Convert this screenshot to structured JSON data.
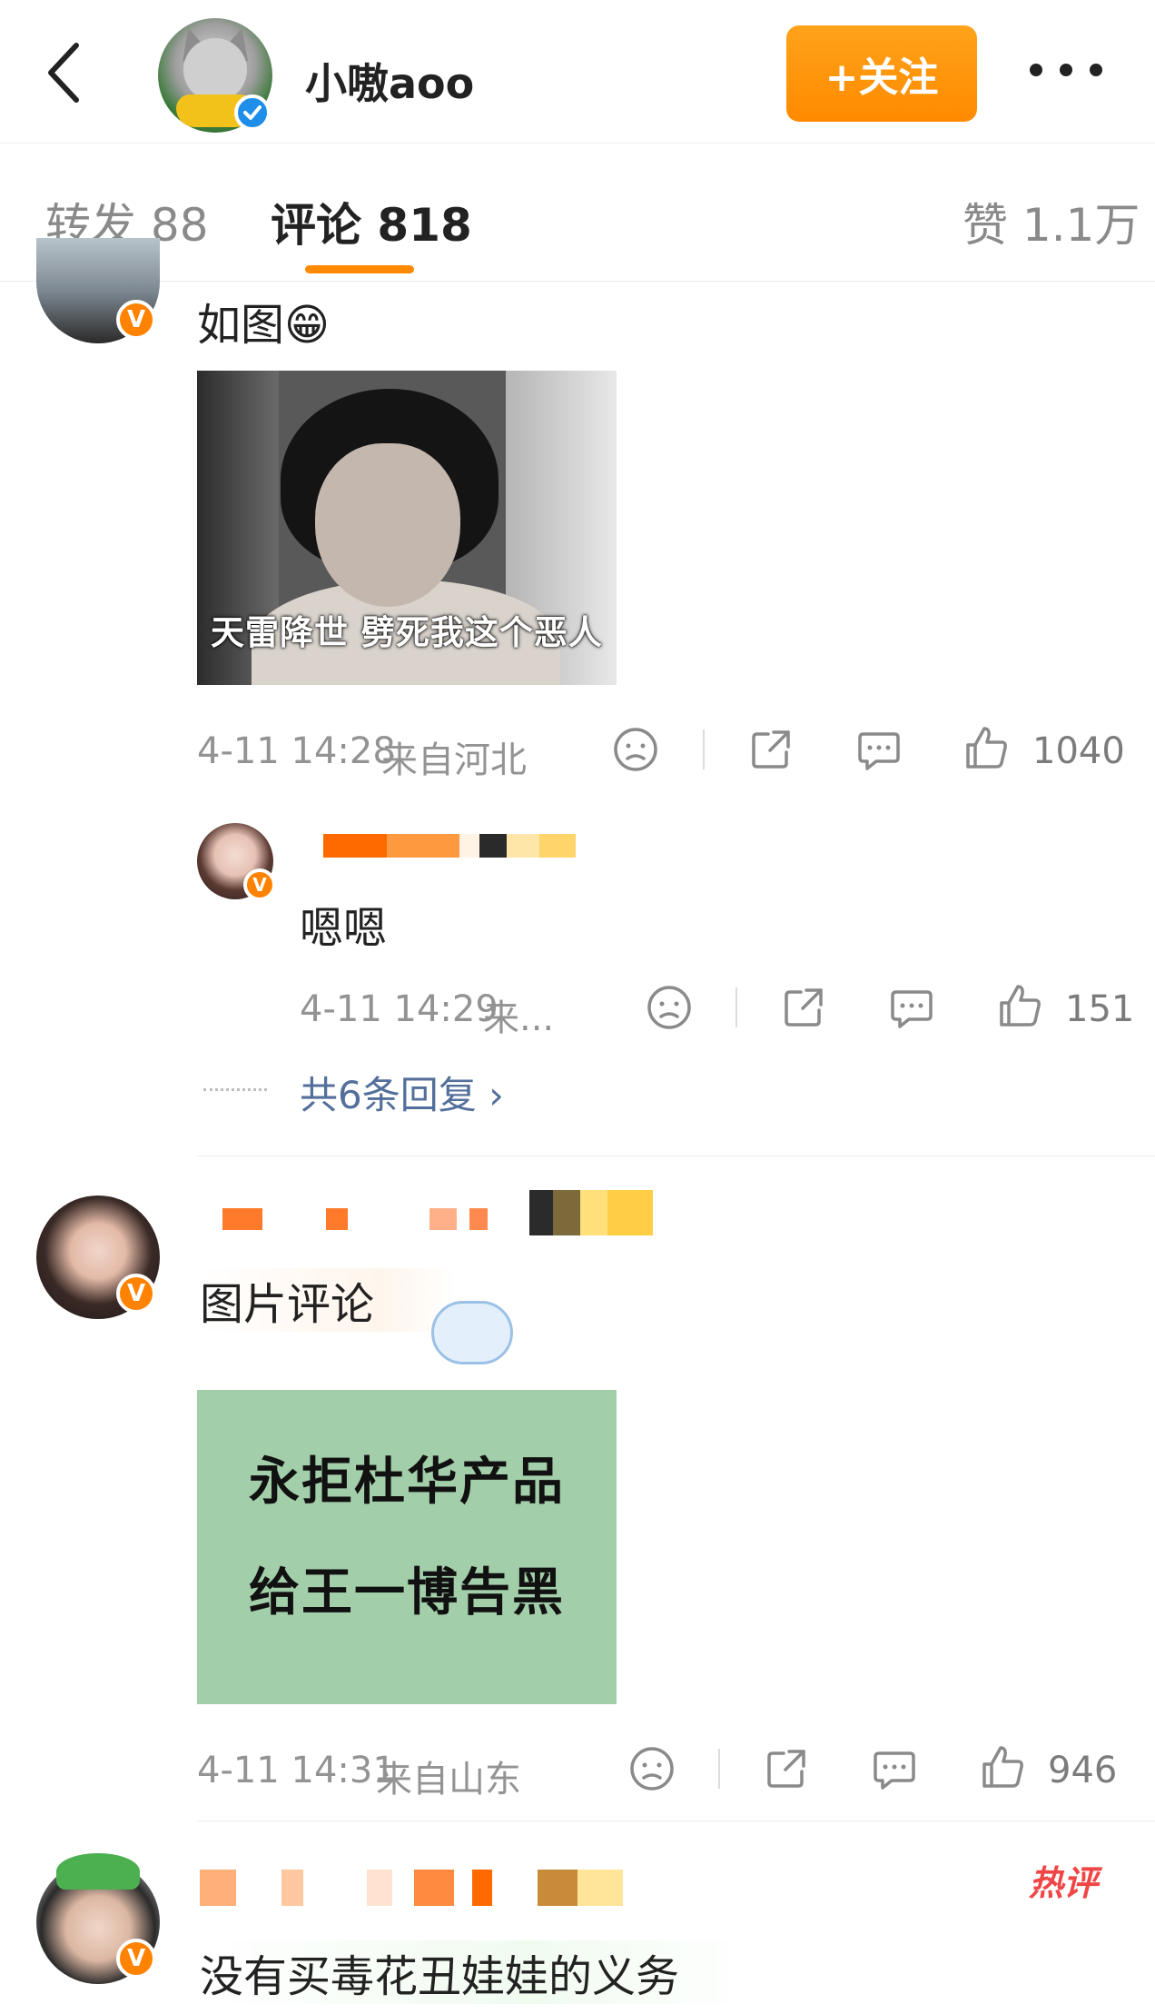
{
  "header": {
    "username": "小嗷aoo",
    "follow_label": "+关注"
  },
  "tabs": {
    "repost": "转发 88",
    "comments": "评论 818",
    "likes": "赞 1.1万"
  },
  "comments": [
    {
      "text": "如图😁",
      "image_caption": "天雷降世 劈死我这个恶人",
      "time": "4-11 14:28",
      "location": "来自河北",
      "likes": "1040",
      "reply": {
        "text": "嗯嗯",
        "time": "4-11 14:29",
        "location": "来...",
        "likes": "151"
      },
      "more_replies": "共6条回复 ›"
    },
    {
      "text": "图片评论",
      "image_lines": [
        "永拒杜华产品",
        "给王一博告黑"
      ],
      "time": "4-11 14:31",
      "location": "来自山东",
      "likes": "946"
    },
    {
      "hot_tag": "热评",
      "text": "没有买毒花丑娃娃的义务"
    }
  ],
  "colors": {
    "accent": "#ff8a00",
    "link": "#536f9b",
    "verified_orange": "#ff8200",
    "verified_blue": "#1e8ee8",
    "hot": "#f04646"
  }
}
